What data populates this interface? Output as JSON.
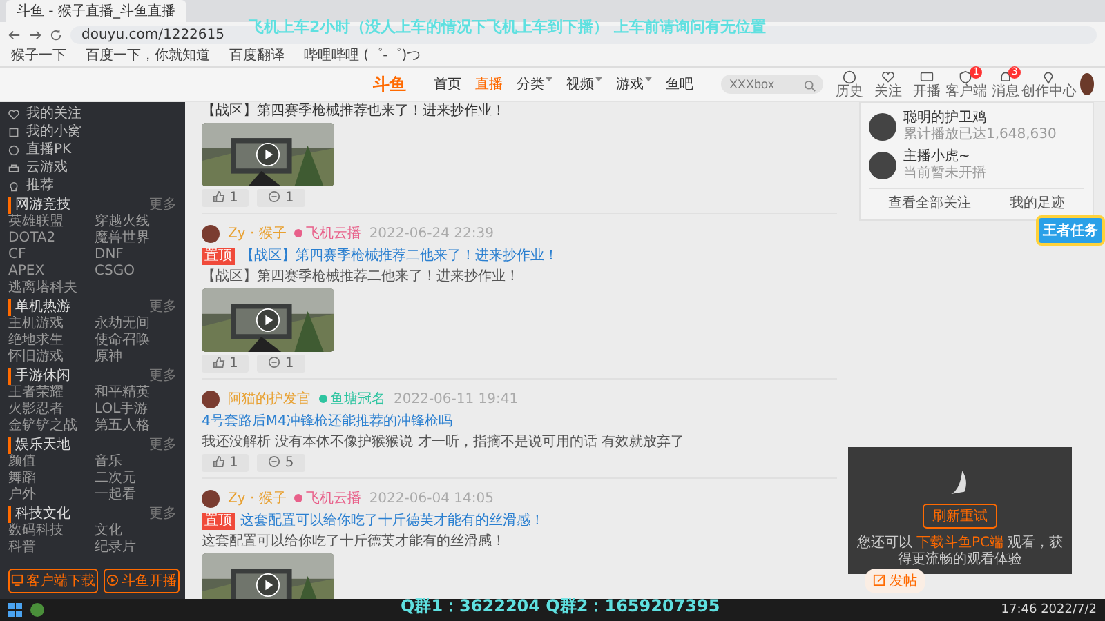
{
  "browser": {
    "tab_title": "斗鱼 - 猴子直播_斗鱼直播",
    "url": "douyu.com/1222615",
    "bookmarks": [
      "猴子一下",
      "百度一下，你就知道",
      "百度翻译",
      "哔哩哔哩 (゜-゜)つ"
    ]
  },
  "overlay": {
    "top": "飞机上车2小时（没人上车的情况下飞机上车到下播） 上车前请询问有无位置",
    "bottom": "Q群1：3622204  Q群2：1659207395"
  },
  "site_header": {
    "logo": "斗鱼",
    "nav": [
      {
        "label": "首页",
        "selected": false
      },
      {
        "label": "直播",
        "selected": true
      },
      {
        "label": "分类",
        "selected": false,
        "dropdown": true
      },
      {
        "label": "视频",
        "selected": false,
        "dropdown": true
      },
      {
        "label": "游戏",
        "selected": false,
        "dropdown": true
      },
      {
        "label": "鱼吧",
        "selected": false
      }
    ],
    "search": {
      "placeholder": "XXXbox"
    },
    "icons": [
      {
        "kind": "clock",
        "label": "历史"
      },
      {
        "kind": "heart",
        "label": "关注"
      },
      {
        "kind": "screen",
        "label": "开播"
      },
      {
        "kind": "shield",
        "label": "客户端",
        "badge": "1"
      },
      {
        "kind": "bell",
        "label": "消息",
        "badge": "3"
      },
      {
        "kind": "pin",
        "label": "创作中心"
      }
    ]
  },
  "sidebar": {
    "nav": [
      {
        "kind": "heart",
        "label": "我的关注"
      },
      {
        "kind": "box",
        "label": "我的小窝"
      },
      {
        "kind": "clock",
        "label": "直播PK"
      },
      {
        "kind": "gamepad",
        "label": "云游戏"
      },
      {
        "kind": "bulb",
        "label": "推荐"
      }
    ],
    "sections": [
      {
        "title": "网游竞技",
        "more": "更多",
        "items": [
          "英雄联盟",
          "穿越火线",
          "DOTA2",
          "魔兽世界",
          "CF",
          "DNF",
          "APEX",
          "CSGO",
          "逃离塔科夫"
        ]
      },
      {
        "title": "单机热游",
        "more": "更多",
        "items": [
          "主机游戏",
          "永劫无间",
          "绝地求生",
          "使命召唤",
          "怀旧游戏",
          "原神"
        ]
      },
      {
        "title": "手游休闲",
        "more": "更多",
        "items": [
          "王者荣耀",
          "和平精英",
          "火影忍者",
          "LOL手游",
          "金铲铲之战",
          "第五人格"
        ]
      },
      {
        "title": "娱乐天地",
        "more": "更多",
        "items": [
          "颜值",
          "音乐",
          "舞蹈",
          "二次元",
          "户外",
          "一起看"
        ]
      },
      {
        "title": "科技文化",
        "more": "更多",
        "items": [
          "数码科技",
          "文化",
          "科普",
          "纪录片"
        ]
      }
    ],
    "buttons": [
      {
        "kind": "download",
        "label": "客户端下载"
      },
      {
        "kind": "live",
        "label": "斗鱼开播"
      }
    ]
  },
  "feed": [
    {
      "title": "【战区】第四赛季枪械推荐也来了！进来抄作业！",
      "video": true,
      "likes": "1",
      "comments": "1"
    },
    {
      "author": "Zy · 猴子",
      "badge": "飞机云播",
      "color": "#e8608a",
      "date": "2022-06-24 22:39",
      "tag": "置顶",
      "title": "【战区】第四赛季枪械推荐二他来了！进来抄作业！",
      "body": "【战区】第四赛季枪械推荐二他来了！进来抄作业！",
      "video": true,
      "likes": "1",
      "comments": "1"
    },
    {
      "author": "阿猫的护发官",
      "badge": "鱼塘冠名",
      "color": "#2ec4a0",
      "date": "2022-06-11 19:41",
      "title": "4号套路后M4冲锋枪还能推荐的冲锋枪吗",
      "body": "我还没解析 没有本体不像护猴猴说 才一听，指摘不是说可用的话 有效就放弃了",
      "likes": "1",
      "comments": "5"
    },
    {
      "author": "Zy · 猴子",
      "badge": "飞机云播",
      "color": "#e8608a",
      "date": "2022-06-04 14:05",
      "tag": "置顶",
      "title": "这套配置可以给你吃了十斤德芙才能有的丝滑感！",
      "body": "这套配置可以给你吃了十斤德芙才能有的丝滑感！",
      "video": true
    }
  ],
  "follow_card": {
    "users": [
      {
        "name": "聪明的护卫鸡",
        "desc": "累计播放已达1,648,630"
      },
      {
        "name": "主播小虎~",
        "desc": "当前暂未开播"
      }
    ],
    "buttons": [
      "查看全部关注",
      "我的足迹"
    ]
  },
  "task_badge": "王者任务",
  "player": {
    "button": "刷新重试",
    "message_before": "您还可以",
    "message_link": "下载斗鱼PC端",
    "message_after": "观看，获得更流畅的观看体验"
  },
  "publish_button": "发帖",
  "taskbar": {
    "time": "17:46",
    "date": "2022/7/2"
  }
}
